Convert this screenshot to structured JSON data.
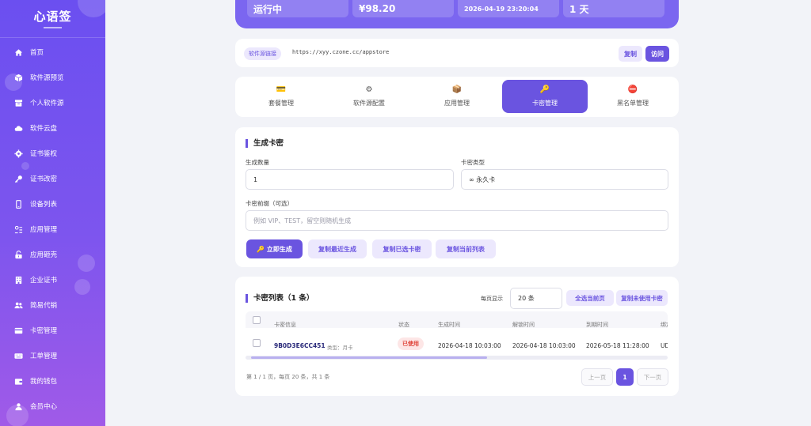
{
  "app": {
    "title": "心语签"
  },
  "sidebar": {
    "items": [
      {
        "label": "首页",
        "icon": "home-icon"
      },
      {
        "label": "软件源预览",
        "icon": "cube-icon"
      },
      {
        "label": "个人软件源",
        "icon": "archive-icon"
      },
      {
        "label": "软件云盘",
        "icon": "cloud-icon"
      },
      {
        "label": "证书鉴权",
        "icon": "gear-icon"
      },
      {
        "label": "证书改密",
        "icon": "key-icon"
      },
      {
        "label": "设备列表",
        "icon": "phone-icon"
      },
      {
        "label": "应用管理",
        "icon": "apps-icon"
      },
      {
        "label": "应用砸壳",
        "icon": "unlock-icon"
      },
      {
        "label": "企业证书",
        "icon": "building-icon"
      },
      {
        "label": "简易代销",
        "icon": "users-icon"
      },
      {
        "label": "卡密管理",
        "icon": "card-icon"
      },
      {
        "label": "工单管理",
        "icon": "keyboard-icon"
      },
      {
        "label": "我的钱包",
        "icon": "wallet-icon"
      },
      {
        "label": "会员中心",
        "icon": "user-icon"
      }
    ]
  },
  "stats": {
    "status": "运行中",
    "balance": "¥98.20",
    "time": "2026-04-19 23:20:04",
    "days": "1 天"
  },
  "source": {
    "tag": "软件源链接",
    "url": "https://xyy.czone.cc/appstore",
    "copy_label": "复制",
    "visit_label": "访问"
  },
  "tabs": [
    {
      "label": "套餐管理",
      "icon": "💳"
    },
    {
      "label": "软件源配置",
      "icon": "⚙"
    },
    {
      "label": "应用管理",
      "icon": "📦"
    },
    {
      "label": "卡密管理",
      "icon": "🔑"
    },
    {
      "label": "黑名单管理",
      "icon": "⛔"
    }
  ],
  "generate": {
    "title": "生成卡密",
    "count_label": "生成数量",
    "count_value": "1",
    "type_label": "卡密类型",
    "type_value": "∞ 永久卡",
    "prefix_label": "卡密前缀（可选）",
    "prefix_placeholder": "例如 VIP、TEST，留空则随机生成",
    "btn_generate": "🔑 立即生成",
    "btn_copy_recent": "复制最近生成",
    "btn_copy_selected": "复制已选卡密",
    "btn_copy_list": "复制当前列表"
  },
  "list": {
    "title": "卡密列表（1 条）",
    "per_page_label": "每页显示",
    "per_page_value": "20 条",
    "btn_select_page": "全选当前页",
    "btn_copy_unused": "复制未使用卡密",
    "columns": [
      "卡密信息",
      "状态",
      "生成时间",
      "解锁时间",
      "到期时间",
      "绑定"
    ],
    "rows": [
      {
        "code": "9B0D3E6CC451",
        "type": "类型：月卡",
        "status": "已使用",
        "created": "2026-04-18 10:03:00",
        "unlocked": "2026-04-18 10:03:00",
        "expires": "2026-05-18 11:28:00",
        "bind": "UD"
      }
    ],
    "pager_info": "第 1 / 1 页，每页 20 条，共 1 条",
    "prev_label": "上一页",
    "page_num": "1",
    "next_label": "下一页"
  },
  "colors": {
    "accent": "#6a54e0",
    "sidebar_top": "#6b4ff0",
    "sidebar_bottom": "#a05ae8",
    "danger": "#e0443a"
  }
}
